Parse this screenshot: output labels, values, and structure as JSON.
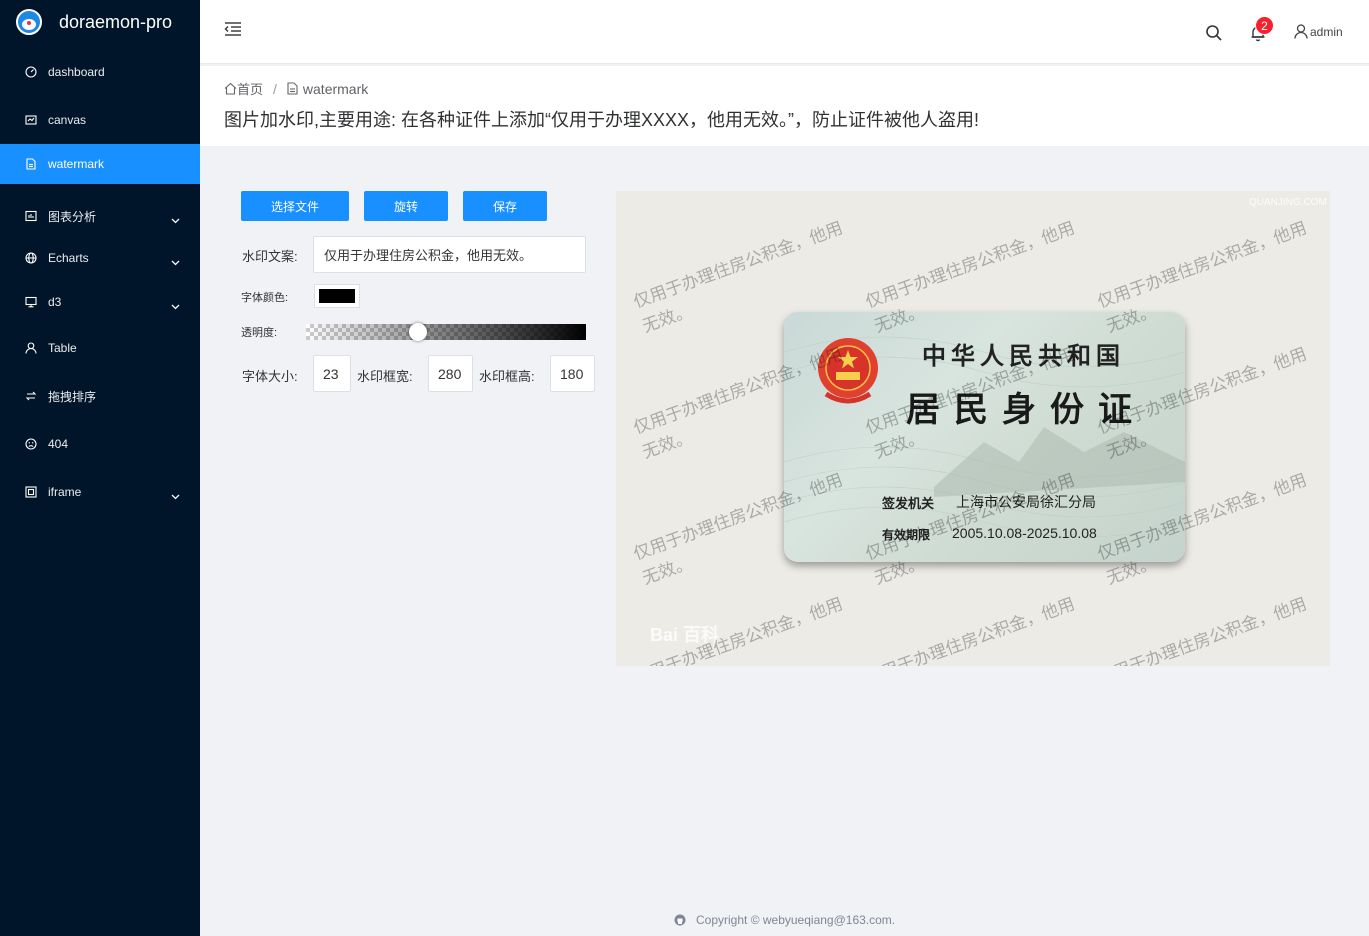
{
  "app": {
    "name": "doraemon-pro"
  },
  "sidebar": {
    "items": [
      {
        "label": "dashboard",
        "icon": "dashboard-icon",
        "active": false,
        "submenu": false
      },
      {
        "label": "canvas",
        "icon": "canvas-icon",
        "active": false,
        "submenu": false
      },
      {
        "label": "watermark",
        "icon": "file-icon",
        "active": true,
        "submenu": false
      },
      {
        "label": "图表分析",
        "icon": "chart-icon",
        "active": false,
        "submenu": true
      },
      {
        "label": "Echarts",
        "icon": "globe-icon",
        "active": false,
        "submenu": true
      },
      {
        "label": "d3",
        "icon": "monitor-icon",
        "active": false,
        "submenu": true
      },
      {
        "label": "Table",
        "icon": "user-icon",
        "active": false,
        "submenu": false
      },
      {
        "label": "拖拽排序",
        "icon": "swap-icon",
        "active": false,
        "submenu": false
      },
      {
        "label": "404",
        "icon": "frown-icon",
        "active": false,
        "submenu": false
      },
      {
        "label": "iframe",
        "icon": "iframe-icon",
        "active": false,
        "submenu": true
      }
    ]
  },
  "header": {
    "notification_count": "2",
    "user": "admin"
  },
  "breadcrumb": {
    "home": "首页",
    "separator": "/",
    "current": "watermark"
  },
  "page": {
    "description": "图片加水印,主要用途: 在各种证件上添加“仅用于办理XXXX，他用无效。”，防止证件被他人盗用!"
  },
  "controls": {
    "select_file": "选择文件",
    "rotate": "旋转",
    "save": "保存",
    "watermark_text_label": "水印文案:",
    "watermark_text": "仅用于办理住房公积金，他用无效。",
    "font_color_label": "字体颜色:",
    "font_color": "#000000",
    "opacity_label": "透明度:",
    "opacity": 0.4,
    "font_size_label": "字体大小:",
    "font_size": "23",
    "box_width_label": "水印框宽:",
    "box_width": "280",
    "box_height_label": "水印框高:",
    "box_height": "180"
  },
  "preview": {
    "watermark_text": "仅用于办理住房公积金，他用无效。",
    "card": {
      "title1": "中华人民共和国",
      "title2": "居民身份证",
      "issuer_label": "签发机关",
      "issuer": "上海市公安局徐汇分局",
      "validity_label": "有效期限",
      "validity": "2005.10.08-2025.10.08"
    },
    "baidu_mark": "Bai 百科",
    "corner_mark": "QUANJING.COM"
  },
  "footer": {
    "text": "Copyright © webyueqiang@163.com."
  },
  "colors": {
    "sidebar_bg": "#001529",
    "accent": "#1890ff",
    "badge": "#f5222d"
  }
}
